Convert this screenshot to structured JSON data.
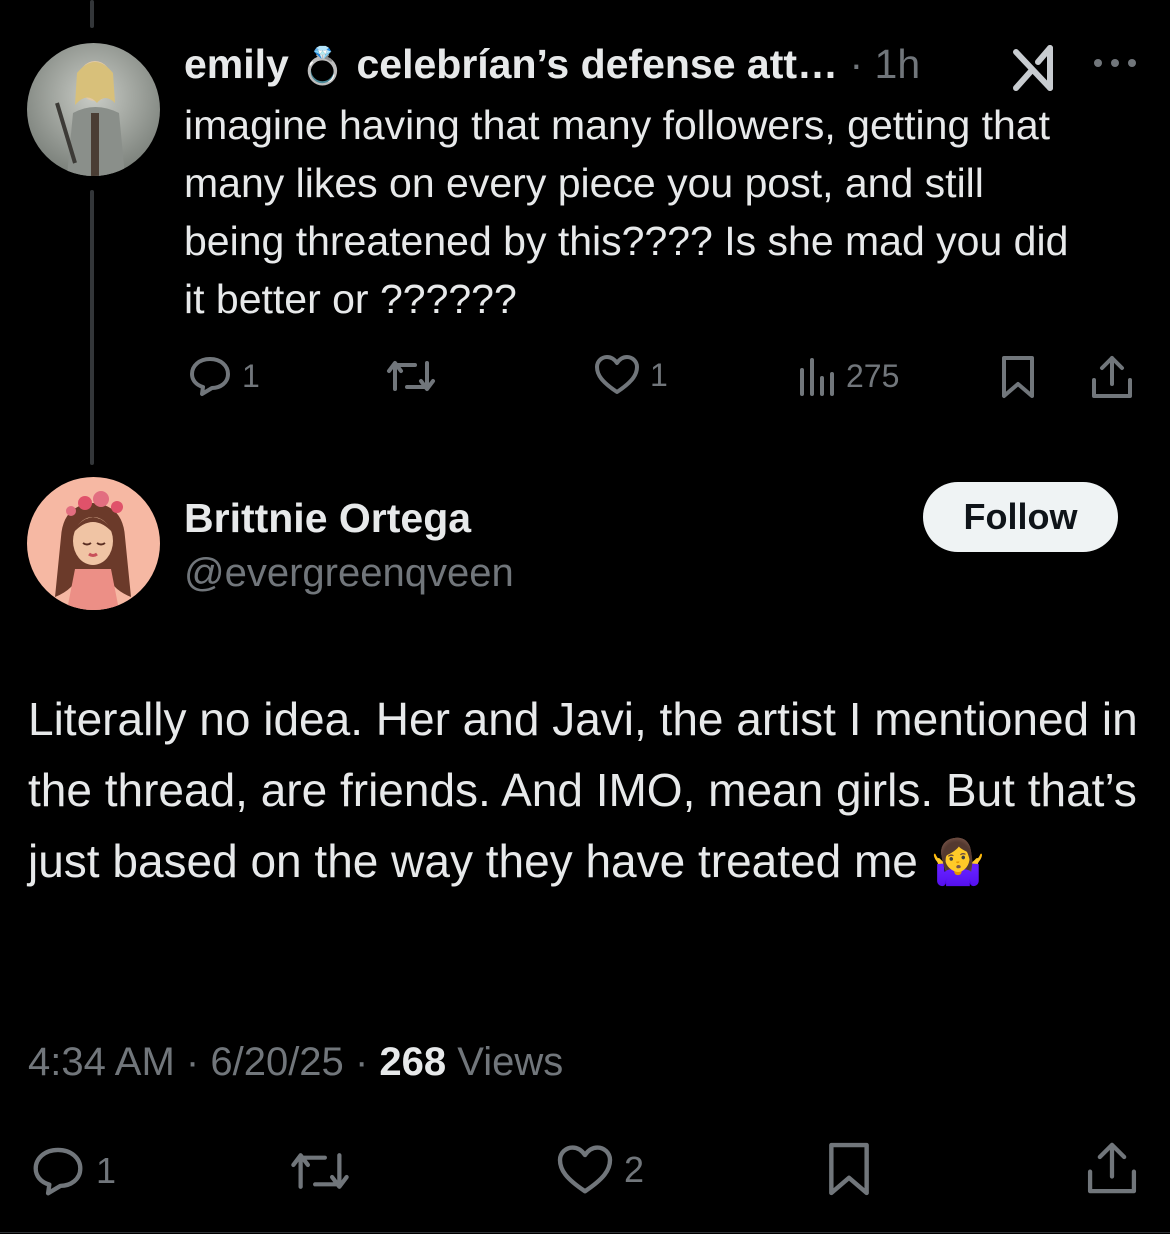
{
  "parent_post": {
    "display_name": "emily",
    "ring_emoji": "💍",
    "handle_text": "celebrían’s defense att…",
    "separator": "·",
    "time": "1h",
    "body": "imagine having that many followers, getting that many likes on every piece you post, and still being threatened by this???? Is she mad you did it better or ??????",
    "replies": "1",
    "likes": "1",
    "views": "275"
  },
  "main_post": {
    "display_name": "Brittnie Ortega",
    "handle": "@evergreenqveen",
    "follow_label": "Follow",
    "body": "Literally no idea. Her and Javi, the artist I mentioned in the thread, are friends. And IMO, mean girls. But that’s just based on the way they have treated me",
    "emoji": "🤷‍♀️",
    "time": "4:34 AM",
    "date": "6/20/25",
    "views_count": "268",
    "views_label": "Views",
    "replies": "1",
    "likes": "2"
  },
  "colors": {
    "background": "#000000",
    "text": "#e7e9ea",
    "muted": "#71767b",
    "follow_bg": "#eff3f4"
  },
  "icons": [
    "reply-icon",
    "repost-icon",
    "like-icon",
    "views-icon",
    "bookmark-icon",
    "share-icon",
    "grok-icon",
    "more-icon"
  ]
}
